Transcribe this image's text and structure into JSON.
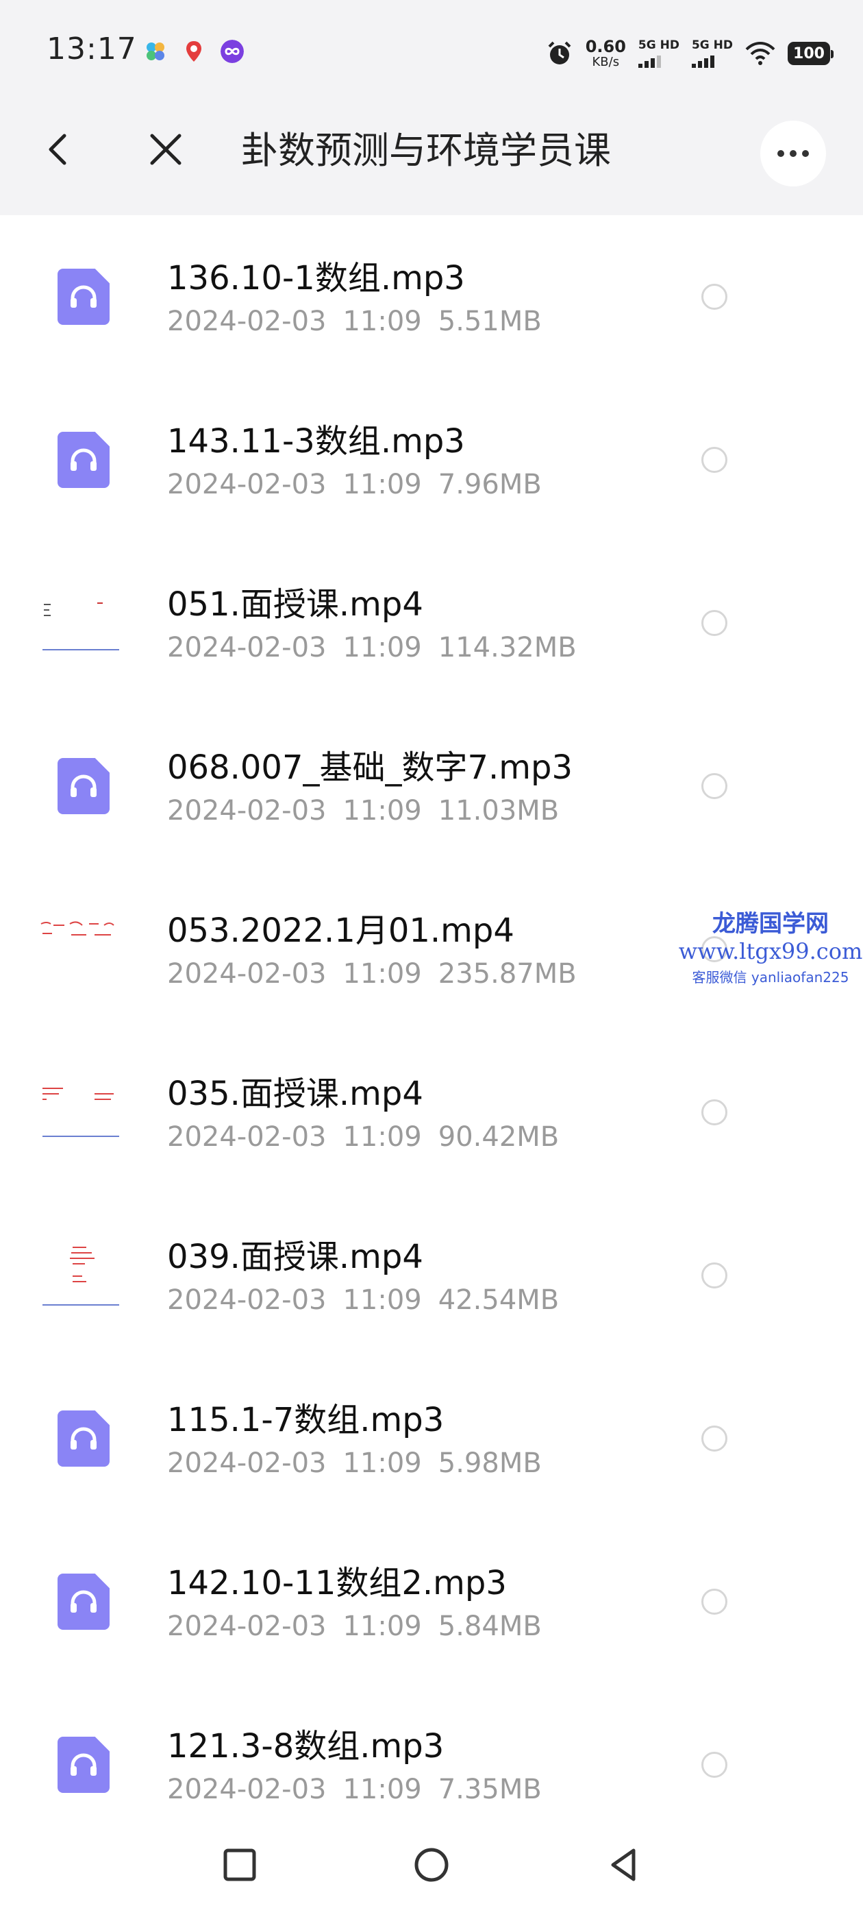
{
  "status_bar": {
    "time": "13:17",
    "net_speed": "0.60",
    "net_unit": "KB/s",
    "sim1_label": "5G HD",
    "sim2_label": "5G HD",
    "battery": "100"
  },
  "header": {
    "title": "卦数预测与环境学员课",
    "back_icon": "chevron-left-icon",
    "close_icon": "close-icon",
    "more_icon": "more-horizontal-icon"
  },
  "files": [
    {
      "name": "136.10-1数组.mp3",
      "date": "2024-02-03",
      "time": "11:09",
      "size": "5.51MB",
      "type": "audio"
    },
    {
      "name": "143.11-3数组.mp3",
      "date": "2024-02-03",
      "time": "11:09",
      "size": "7.96MB",
      "type": "audio"
    },
    {
      "name": "051.面授课.mp4",
      "date": "2024-02-03",
      "time": "11:09",
      "size": "114.32MB",
      "type": "video"
    },
    {
      "name": "068.007_基础_数字7.mp3",
      "date": "2024-02-03",
      "time": "11:09",
      "size": "11.03MB",
      "type": "audio"
    },
    {
      "name": "053.2022.1月01.mp4",
      "date": "2024-02-03",
      "time": "11:09",
      "size": "235.87MB",
      "type": "video"
    },
    {
      "name": "035.面授课.mp4",
      "date": "2024-02-03",
      "time": "11:09",
      "size": "90.42MB",
      "type": "video"
    },
    {
      "name": "039.面授课.mp4",
      "date": "2024-02-03",
      "time": "11:09",
      "size": "42.54MB",
      "type": "video"
    },
    {
      "name": "115.1-7数组.mp3",
      "date": "2024-02-03",
      "time": "11:09",
      "size": "5.98MB",
      "type": "audio"
    },
    {
      "name": "142.10-11数组2.mp3",
      "date": "2024-02-03",
      "time": "11:09",
      "size": "5.84MB",
      "type": "audio"
    },
    {
      "name": "121.3-8数组.mp3",
      "date": "2024-02-03",
      "time": "11:09",
      "size": "7.35MB",
      "type": "audio"
    }
  ],
  "watermark": {
    "title": "龙腾国学网",
    "url": "www.ltgx99.com",
    "contact": "客服微信 yanliaofan225"
  },
  "nav_bar": {
    "recents_icon": "square-icon",
    "home_icon": "circle-icon",
    "back_icon": "triangle-back-icon"
  },
  "colors": {
    "audio_icon": "#8a84f5",
    "header_bg": "#f3f3f5",
    "meta_text": "#9a9a9a",
    "watermark": "#3b5bd6"
  }
}
